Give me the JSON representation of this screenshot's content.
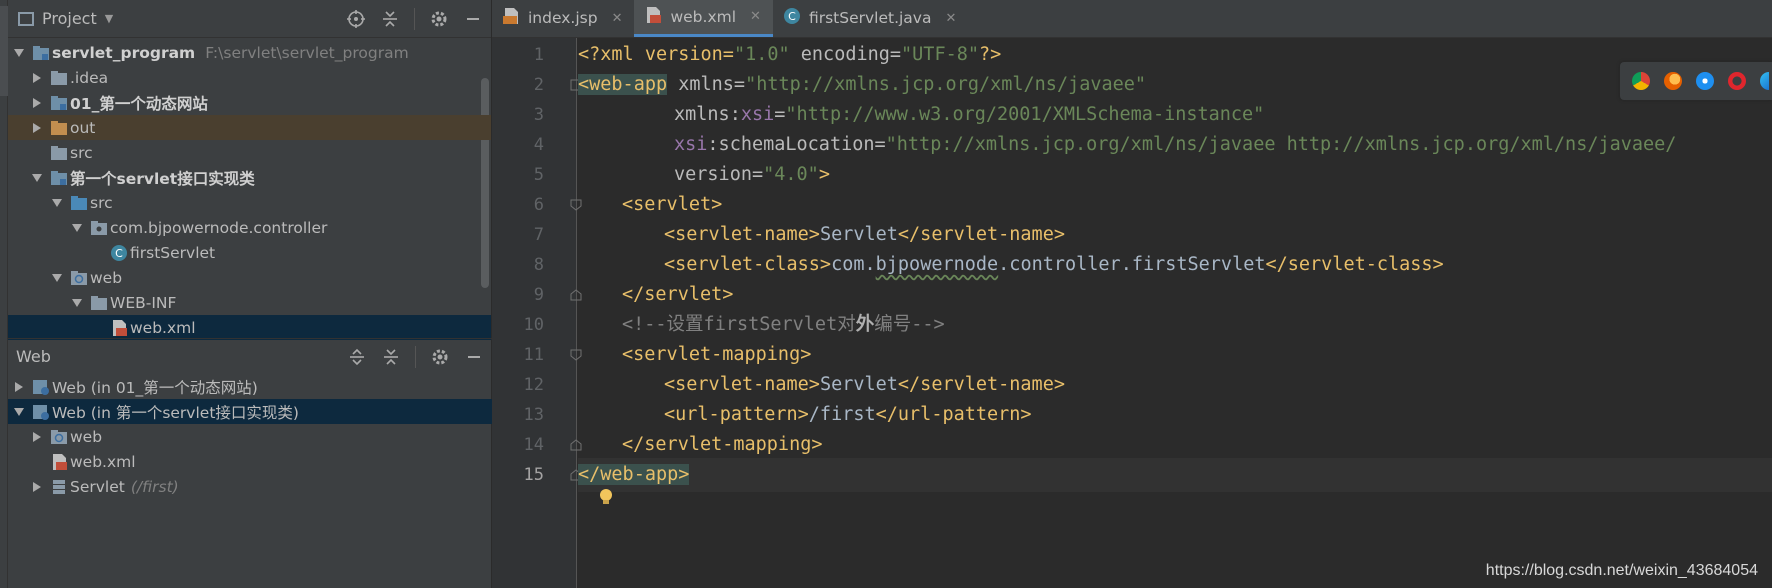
{
  "project_panel": {
    "title": "Project",
    "tree": [
      {
        "label": "servlet_program",
        "path": "F:\\servlet\\servlet_program",
        "bold": true
      },
      {
        "label": ".idea"
      },
      {
        "label": "01_第一个动态网站",
        "bold": true
      },
      {
        "label": "out"
      },
      {
        "label": "src"
      },
      {
        "label": "第一个servlet接口实现类",
        "bold": true
      },
      {
        "label": "src"
      },
      {
        "label": "com.bjpowernode.controller"
      },
      {
        "label": "firstServlet"
      },
      {
        "label": "web"
      },
      {
        "label": "WEB-INF"
      },
      {
        "label": "web.xml"
      }
    ]
  },
  "web_panel": {
    "title": "Web",
    "tree": [
      {
        "label": "Web (in 01_第一个动态网站)"
      },
      {
        "label": "Web (in 第一个servlet接口实现类)"
      },
      {
        "label": "web"
      },
      {
        "label": "web.xml"
      },
      {
        "label": "Servlet",
        "note": "(/first)"
      }
    ]
  },
  "tabs": [
    {
      "label": "index.jsp",
      "icon": "jsp-file-icon",
      "active": false
    },
    {
      "label": "web.xml",
      "icon": "xml-file-icon",
      "active": true
    },
    {
      "label": "firstServlet.java",
      "icon": "java-class-icon",
      "active": false
    }
  ],
  "line_numbers": [
    "1",
    "2",
    "3",
    "4",
    "5",
    "6",
    "7",
    "8",
    "9",
    "10",
    "11",
    "12",
    "13",
    "14",
    "15"
  ],
  "current_line": "15",
  "code": {
    "l1": [
      "<?xml version=",
      "\"1.0\"",
      " encoding=",
      "\"UTF-8\"",
      "?>"
    ],
    "l2": [
      "<web-app",
      " xmlns=",
      "\"http://xmlns.jcp.org/xml/ns/javaee\""
    ],
    "l3": [
      "xmlns:",
      "xsi",
      "=",
      "\"http://www.w3.org/2001/XMLSchema-instance\""
    ],
    "l4": [
      "xsi",
      ":schemaLocation=",
      "\"http://xmlns.jcp.org/xml/ns/javaee http://xmlns.jcp.org/xml/ns/javaee/"
    ],
    "l5": [
      "version=",
      "\"4.0\"",
      ">"
    ],
    "l6": [
      "<servlet>"
    ],
    "l7": [
      "<servlet-name>",
      "Servlet",
      "</servlet-name>"
    ],
    "l8": [
      "<servlet-class>",
      "com.",
      "bjpowernode",
      ".controller.firstServlet",
      "</servlet-class>"
    ],
    "l9": [
      "</servlet>"
    ],
    "l10": [
      "<!--设置firstServlet对",
      "外",
      "编号-->"
    ],
    "l11": [
      "<servlet-mapping>"
    ],
    "l12": [
      "<servlet-name>",
      "Servlet",
      "</servlet-name>"
    ],
    "l13": [
      "<url-pattern>",
      "/first",
      "</url-pattern>"
    ],
    "l14": [
      "</servlet-mapping>"
    ],
    "l15": [
      "</web-app>"
    ]
  },
  "watermark": "https://blog.csdn.net/weixin_43684054",
  "colors": {
    "tag": "#e8bf6a",
    "value": "#6a8759",
    "namespace": "#9876aa",
    "comment": "#808080",
    "selection": "#0d293e"
  }
}
